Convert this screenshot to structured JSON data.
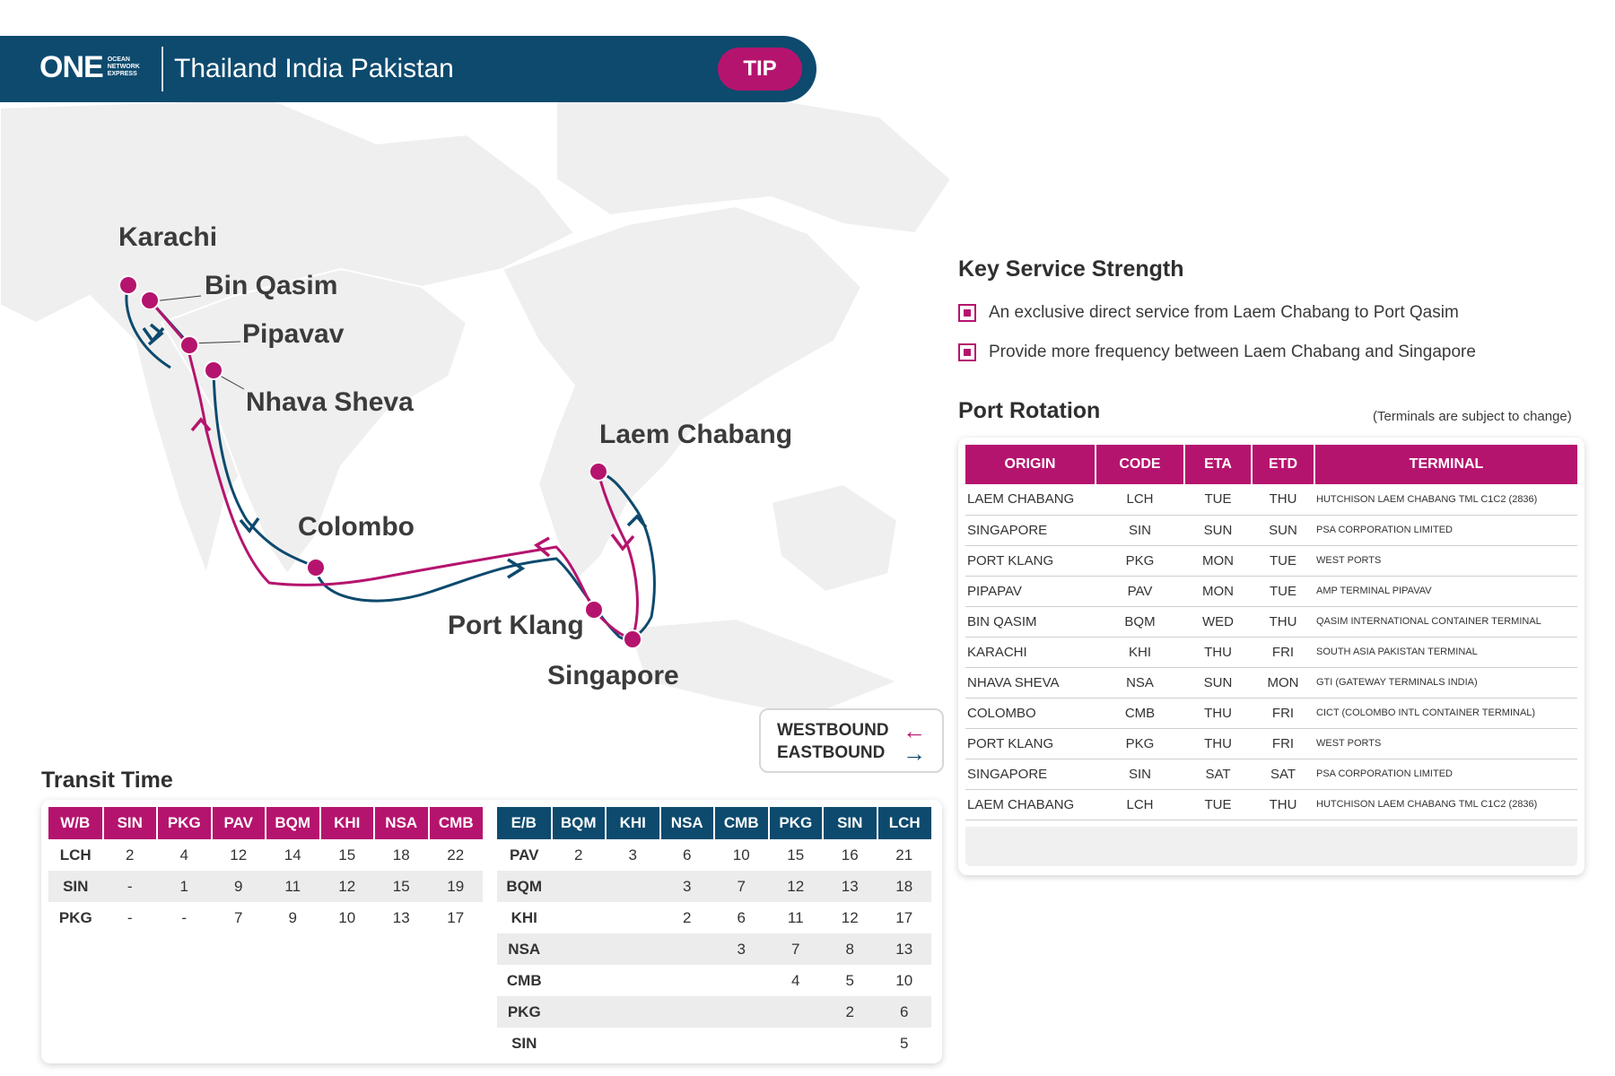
{
  "header": {
    "logo_main": "ONE",
    "logo_sub": [
      "OCEAN",
      "NETWORK",
      "EXPRESS"
    ],
    "service_name": "Thailand India Pakistan",
    "service_code": "TIP"
  },
  "colors": {
    "navy": "#0d4a6e",
    "magenta": "#b5146e",
    "map_land": "#efefef"
  },
  "map": {
    "ports": [
      "Karachi",
      "Bin Qasim",
      "Pipavav",
      "Nhava Sheva",
      "Colombo",
      "Laem Chabang",
      "Port Klang",
      "Singapore"
    ]
  },
  "legend": {
    "westbound": "WESTBOUND",
    "eastbound": "EASTBOUND"
  },
  "key_service": {
    "title": "Key Service Strength",
    "items": [
      "An exclusive direct service from Laem Chabang to Port Qasim",
      "Provide more frequency between Laem Chabang and Singapore"
    ]
  },
  "port_rotation": {
    "title": "Port Rotation",
    "note": "(Terminals are subject to change)",
    "columns": [
      "ORIGIN",
      "CODE",
      "ETA",
      "ETD",
      "TERMINAL"
    ],
    "rows": [
      [
        "LAEM CHABANG",
        "LCH",
        "TUE",
        "THU",
        "HUTCHISON LAEM CHABANG TML C1C2 (2836)"
      ],
      [
        "SINGAPORE",
        "SIN",
        "SUN",
        "SUN",
        "PSA CORPORATION LIMITED"
      ],
      [
        "PORT KLANG",
        "PKG",
        "MON",
        "TUE",
        "WEST PORTS"
      ],
      [
        "PIPAPAV",
        "PAV",
        "MON",
        "TUE",
        "AMP TERMINAL PIPAVAV"
      ],
      [
        "BIN QASIM",
        "BQM",
        "WED",
        "THU",
        "QASIM INTERNATIONAL CONTAINER TERMINAL"
      ],
      [
        "KARACHI",
        "KHI",
        "THU",
        "FRI",
        "SOUTH ASIA PAKISTAN TERMINAL"
      ],
      [
        "NHAVA SHEVA",
        "NSA",
        "SUN",
        "MON",
        "GTI (GATEWAY TERMINALS INDIA)"
      ],
      [
        "COLOMBO",
        "CMB",
        "THU",
        "FRI",
        "CICT (COLOMBO INTL CONTAINER TERMINAL)"
      ],
      [
        "PORT KLANG",
        "PKG",
        "THU",
        "FRI",
        "WEST PORTS"
      ],
      [
        "SINGAPORE",
        "SIN",
        "SAT",
        "SAT",
        "PSA CORPORATION LIMITED"
      ],
      [
        "LAEM CHABANG",
        "LCH",
        "TUE",
        "THU",
        "HUTCHISON LAEM CHABANG TML C1C2 (2836)"
      ]
    ]
  },
  "transit_time": {
    "title": "Transit Time",
    "westbound": {
      "columns": [
        "W/B",
        "SIN",
        "PKG",
        "PAV",
        "BQM",
        "KHI",
        "NSA",
        "CMB"
      ],
      "rows": [
        [
          "LCH",
          "2",
          "4",
          "12",
          "14",
          "15",
          "18",
          "22"
        ],
        [
          "SIN",
          "-",
          "1",
          "9",
          "11",
          "12",
          "15",
          "19"
        ],
        [
          "PKG",
          "-",
          "-",
          "7",
          "9",
          "10",
          "13",
          "17"
        ]
      ]
    },
    "eastbound": {
      "columns": [
        "E/B",
        "BQM",
        "KHI",
        "NSA",
        "CMB",
        "PKG",
        "SIN",
        "LCH"
      ],
      "rows": [
        [
          "PAV",
          "2",
          "3",
          "6",
          "10",
          "15",
          "16",
          "21"
        ],
        [
          "BQM",
          "",
          "",
          "3",
          "7",
          "12",
          "13",
          "18"
        ],
        [
          "KHI",
          "",
          "",
          "2",
          "6",
          "11",
          "12",
          "17"
        ],
        [
          "NSA",
          "",
          "",
          "",
          "3",
          "7",
          "8",
          "13"
        ],
        [
          "CMB",
          "",
          "",
          "",
          "",
          "4",
          "5",
          "10"
        ],
        [
          "PKG",
          "",
          "",
          "",
          "",
          "",
          "2",
          "6"
        ],
        [
          "SIN",
          "",
          "",
          "",
          "",
          "",
          "",
          "5"
        ]
      ]
    }
  }
}
